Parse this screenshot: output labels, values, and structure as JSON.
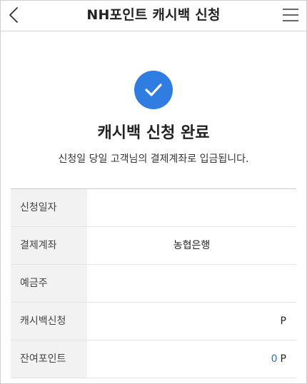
{
  "header": {
    "title": "NH포인트 캐시백 신청",
    "back_icon": "chevron-left-icon",
    "menu_icon": "hamburger-menu-icon"
  },
  "result": {
    "icon": "check-circle-icon",
    "accent_color": "#2f7de1",
    "title": "캐시백 신청 완료",
    "message": "신청일 당일 고객님의 결제계좌로 입금됩니다."
  },
  "details": {
    "rows": [
      {
        "label": "신청일자",
        "value": ""
      },
      {
        "label": "결제계좌",
        "value": "농협은행"
      },
      {
        "label": "예금주",
        "value": ""
      },
      {
        "label": "캐시백신청",
        "value": "",
        "unit": "P"
      },
      {
        "label": "잔여포인트",
        "value": "0",
        "unit": "P"
      }
    ]
  }
}
